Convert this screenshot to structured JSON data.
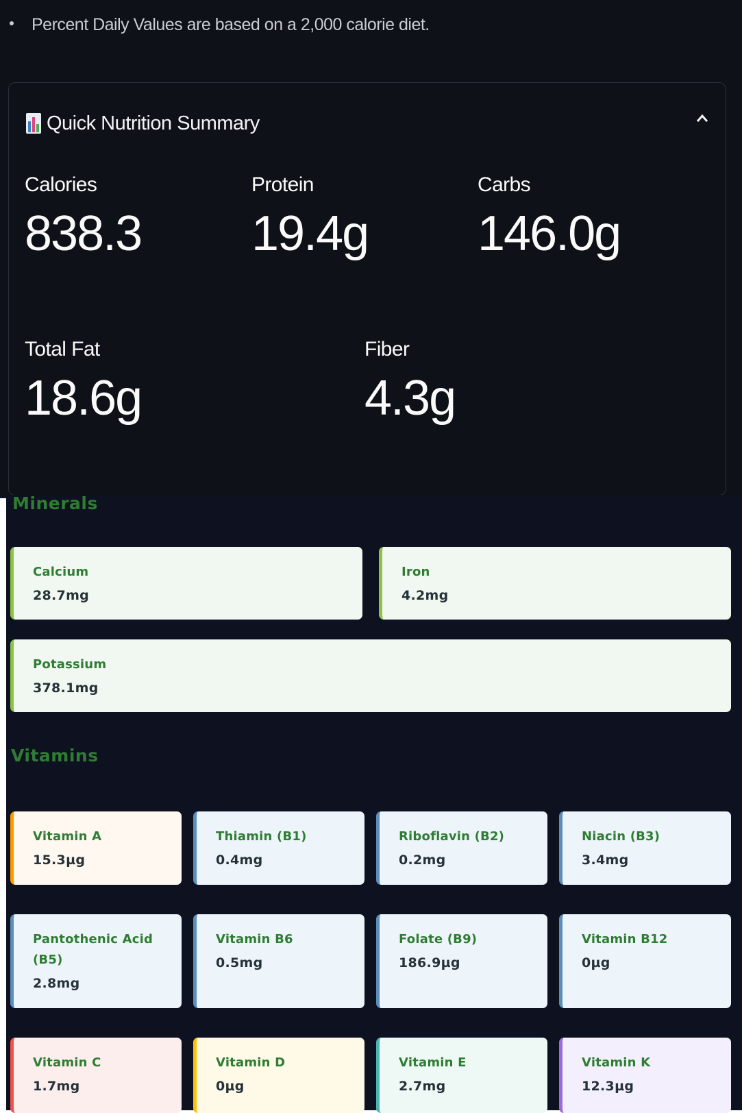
{
  "note": "Percent Daily Values are based on a 2,000 calorie diet.",
  "summary": {
    "title": "Quick Nutrition Summary",
    "metrics": [
      {
        "label": "Calories",
        "value": "838.3"
      },
      {
        "label": "Protein",
        "value": "19.4g"
      },
      {
        "label": "Carbs",
        "value": "146.0g"
      },
      {
        "label": "Total Fat",
        "value": "18.6g"
      },
      {
        "label": "Fiber",
        "value": "4.3g"
      }
    ]
  },
  "minerals": {
    "title": "Minerals",
    "items": [
      {
        "name": "Calcium",
        "value": "28.7mg"
      },
      {
        "name": "Iron",
        "value": "4.2mg"
      },
      {
        "name": "Potassium",
        "value": "378.1mg"
      }
    ]
  },
  "vitamins": {
    "title": "Vitamins",
    "items": [
      {
        "name": "Vitamin A",
        "value": "15.3µg"
      },
      {
        "name": "Thiamin (B1)",
        "value": "0.4mg"
      },
      {
        "name": "Riboflavin (B2)",
        "value": "0.2mg"
      },
      {
        "name": "Niacin (B3)",
        "value": "3.4mg"
      },
      {
        "name": "Pantothenic Acid (B5)",
        "value": "2.8mg"
      },
      {
        "name": "Vitamin B6",
        "value": "0.5mg"
      },
      {
        "name": "Folate (B9)",
        "value": "186.9µg"
      },
      {
        "name": "Vitamin B12",
        "value": "0µg"
      },
      {
        "name": "Vitamin C",
        "value": "1.7mg"
      },
      {
        "name": "Vitamin D",
        "value": "0µg"
      },
      {
        "name": "Vitamin E",
        "value": "2.7mg"
      },
      {
        "name": "Vitamin K",
        "value": "12.3µg"
      }
    ]
  },
  "colors": {
    "mineral_accent": "#8bc34a",
    "mineral_bg": "#f1f8f1",
    "vitamin_a": "#ff9800",
    "vitamin_b": "#5b8fb9",
    "vitamin_c": "#ef5350",
    "vitamin_d": "#ffc107",
    "vitamin_e": "#4db6ac",
    "vitamin_k": "#9c6ade"
  }
}
